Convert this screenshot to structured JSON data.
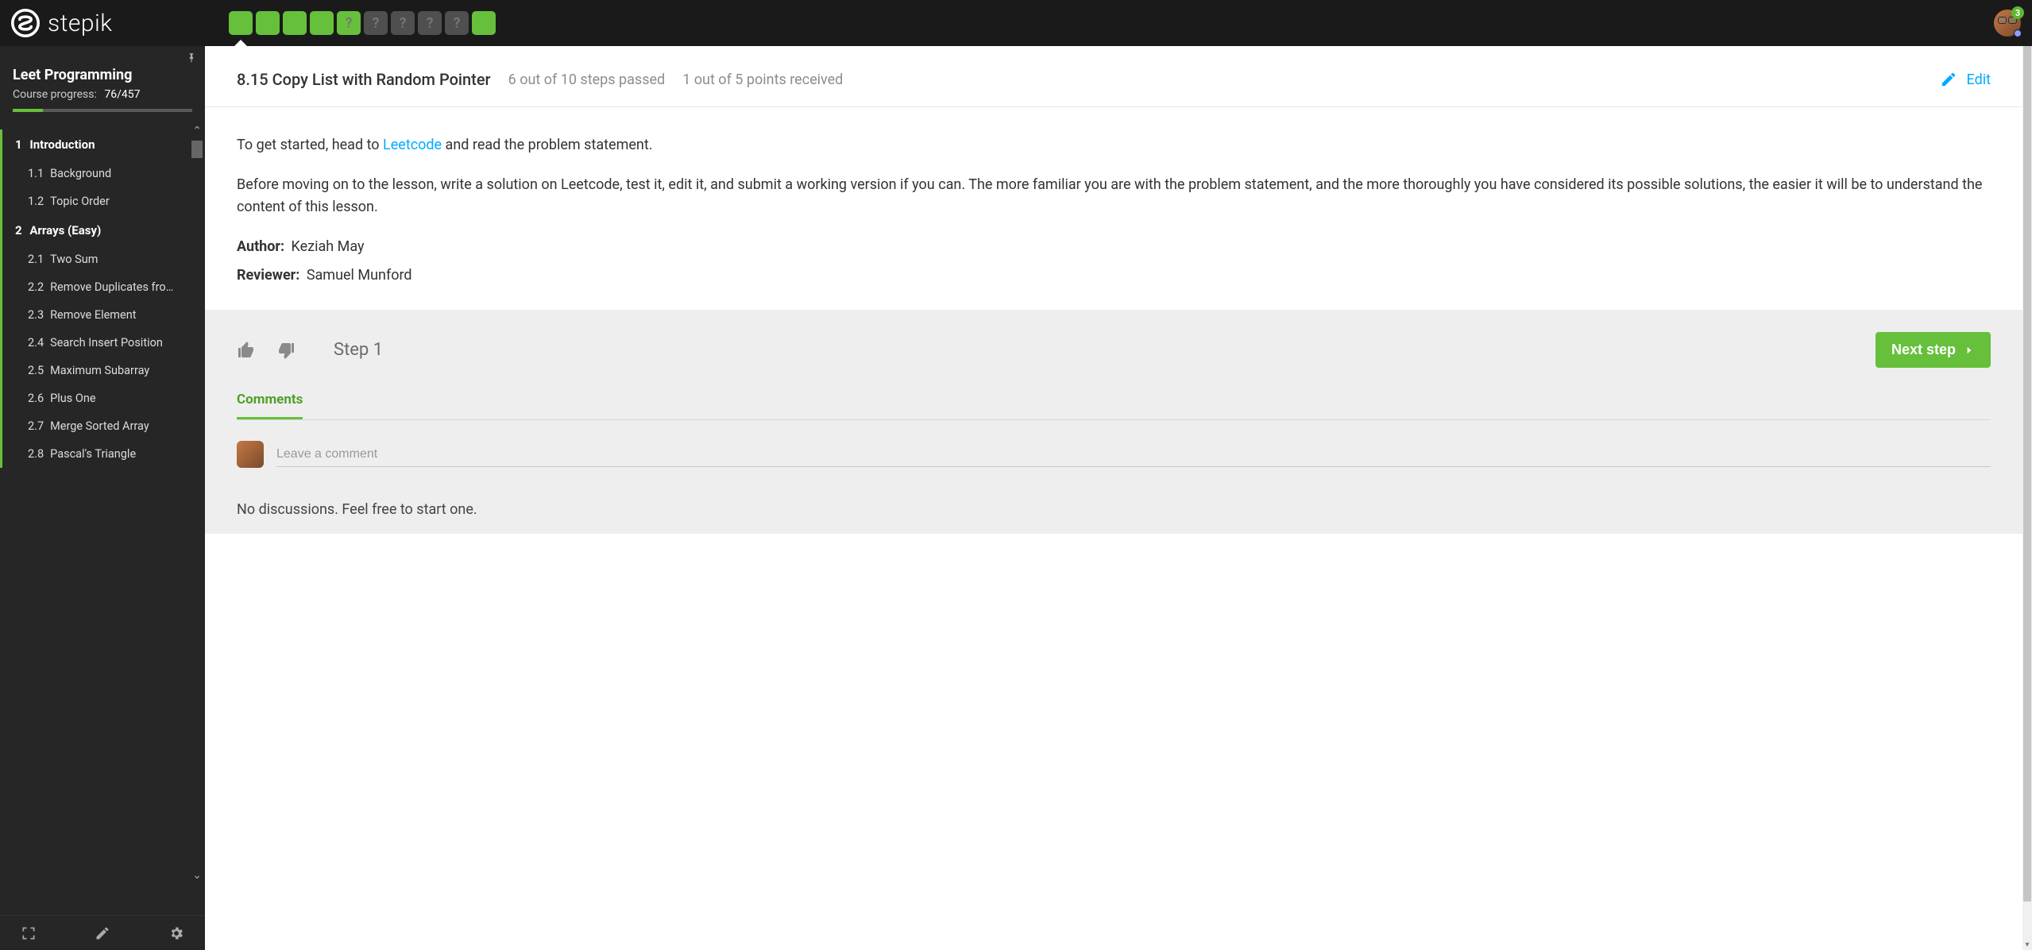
{
  "brand": "stepik",
  "notifications": "3",
  "steps": [
    {
      "state": "green",
      "label": "",
      "active": true
    },
    {
      "state": "green",
      "label": "",
      "active": false
    },
    {
      "state": "green",
      "label": "",
      "active": false
    },
    {
      "state": "green",
      "label": "",
      "active": false
    },
    {
      "state": "green",
      "label": "?",
      "active": false
    },
    {
      "state": "grey",
      "label": "?",
      "active": false
    },
    {
      "state": "grey",
      "label": "?",
      "active": false
    },
    {
      "state": "grey",
      "label": "?",
      "active": false
    },
    {
      "state": "grey",
      "label": "?",
      "active": false
    },
    {
      "state": "green",
      "label": "",
      "active": false
    }
  ],
  "course": {
    "title": "Leet Programming",
    "progress_label": "Course progress:",
    "progress_value": "76/457",
    "progress_ratio": 0.166
  },
  "nav": {
    "sections": [
      {
        "num": "1",
        "title": "Introduction",
        "lessons": [
          {
            "num": "1.1",
            "title": "Background"
          },
          {
            "num": "1.2",
            "title": "Topic Order"
          }
        ]
      },
      {
        "num": "2",
        "title": "Arrays (Easy)",
        "lessons": [
          {
            "num": "2.1",
            "title": "Two Sum"
          },
          {
            "num": "2.2",
            "title": "Remove Duplicates fro…"
          },
          {
            "num": "2.3",
            "title": "Remove Element"
          },
          {
            "num": "2.4",
            "title": "Search Insert Position"
          },
          {
            "num": "2.5",
            "title": "Maximum Subarray"
          },
          {
            "num": "2.6",
            "title": "Plus One"
          },
          {
            "num": "2.7",
            "title": "Merge Sorted Array"
          },
          {
            "num": "2.8",
            "title": "Pascal's Triangle"
          }
        ]
      }
    ]
  },
  "lesson": {
    "title": "8.15 Copy List with Random Pointer",
    "steps_stat": "6 out of 10 steps passed",
    "points_stat": "1 out of 5 points  received",
    "edit_label": "Edit",
    "intro1_before": "To get started, head to ",
    "intro1_link": "Leetcode",
    "intro1_after": " and read the problem statement.",
    "intro2": "Before moving on to the lesson, write a solution on Leetcode, test it, edit it, and submit a working version if you can. The more familiar you are with the problem statement, and the more thoroughly you have considered its possible solutions, the easier it will be to understand the content of this lesson.",
    "author_label": "Author:",
    "author_value": "Keziah May",
    "reviewer_label": "Reviewer:",
    "reviewer_value": "Samuel Munford"
  },
  "footer": {
    "step_label": "Step 1",
    "next_label": "Next step",
    "comments_tab": "Comments",
    "comment_placeholder": "Leave a comment",
    "no_discussions": "No discussions. Feel free to start one."
  }
}
